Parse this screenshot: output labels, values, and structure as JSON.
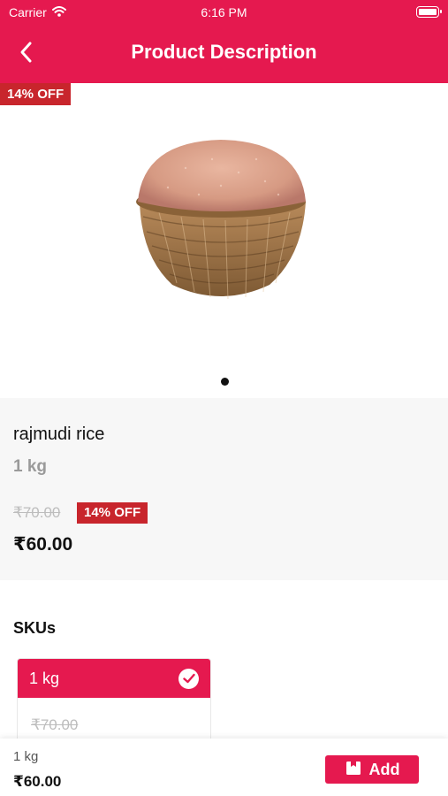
{
  "status_bar": {
    "carrier": "Carrier",
    "time": "6:16 PM"
  },
  "header": {
    "title": "Product Description"
  },
  "discount_flag": "14% OFF",
  "product": {
    "name": "rajmudi rice",
    "weight": "1 kg",
    "old_price": "₹70.00",
    "discount_badge": "14% OFF",
    "price": "₹60.00",
    "image_count": 1
  },
  "skus": {
    "title": "SKUs",
    "items": [
      {
        "label": "1 kg",
        "old_price": "₹70.00",
        "selected": true
      }
    ]
  },
  "bottom_bar": {
    "weight": "1 kg",
    "price": "₹60.00",
    "add_label": "Add"
  },
  "colors": {
    "brand": "#e5194f",
    "discount": "#c8252c"
  }
}
